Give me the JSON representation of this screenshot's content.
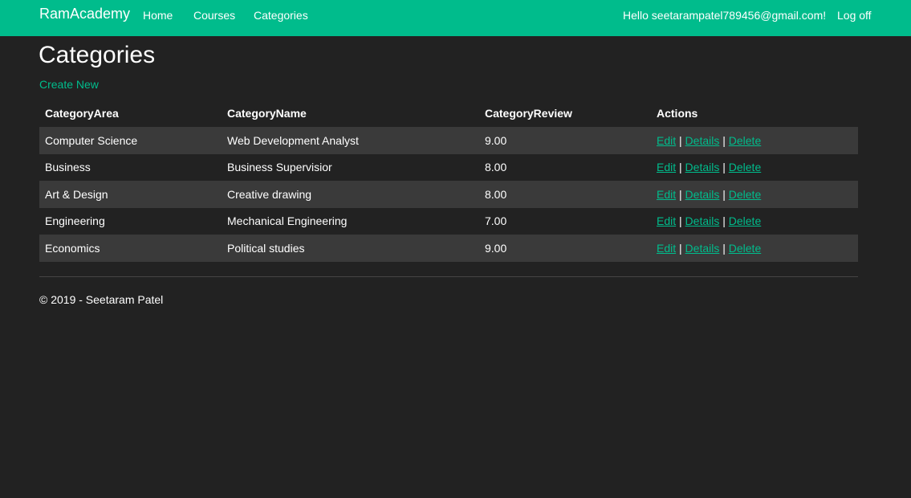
{
  "navbar": {
    "brand": "RamAcademy",
    "links": [
      "Home",
      "Courses",
      "Categories"
    ],
    "greeting": "Hello seetarampatel789456@gmail.com!",
    "logoff": "Log off",
    "color": "#00bc8c"
  },
  "page": {
    "title": "Categories",
    "create_new": "Create New"
  },
  "table": {
    "headers": [
      "CategoryArea",
      "CategoryName",
      "CategoryReview",
      "Actions"
    ],
    "rows": [
      {
        "area": "Computer Science",
        "name": "Web Development Analyst",
        "review": "9.00"
      },
      {
        "area": "Business",
        "name": "Business Supervisior",
        "review": "8.00"
      },
      {
        "area": "Art & Design",
        "name": "Creative drawing",
        "review": "8.00"
      },
      {
        "area": "Engineering",
        "name": "Mechanical Engineering",
        "review": "7.00"
      },
      {
        "area": "Economics",
        "name": "Political studies",
        "review": "9.00"
      }
    ],
    "actions": {
      "edit": "Edit",
      "details": "Details",
      "delete": "Delete",
      "separator": "|"
    }
  },
  "footer": {
    "text": "© 2019 - Seetaram Patel"
  }
}
